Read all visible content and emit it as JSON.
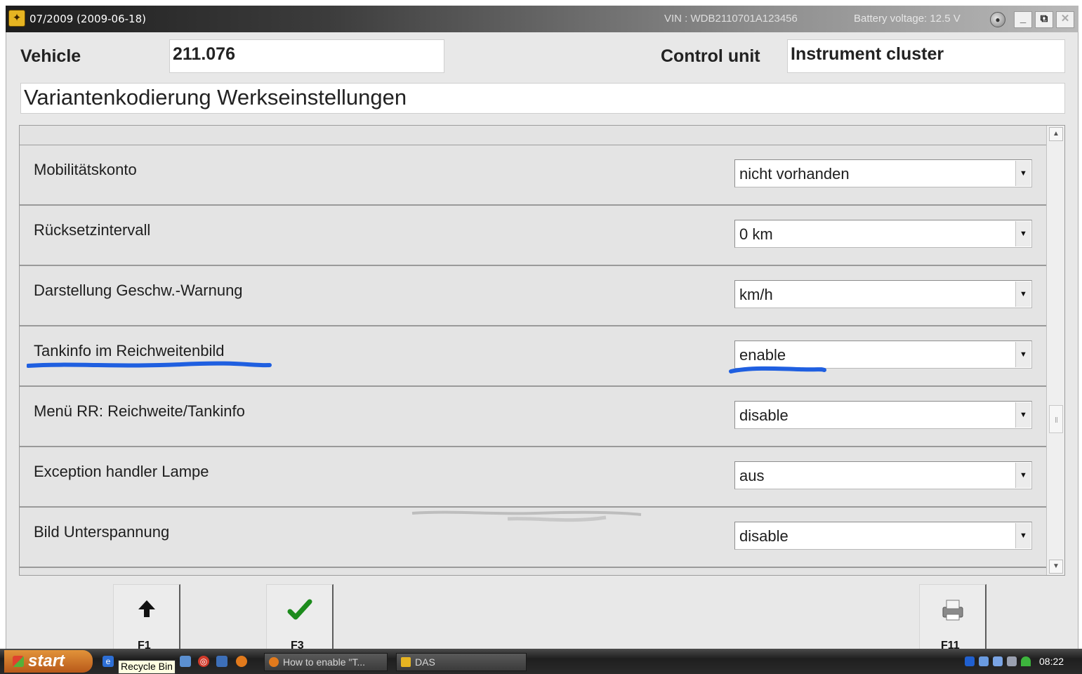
{
  "titlebar": {
    "title": "07/2009 (2009-06-18)",
    "vin": "VIN : WDB2110701A123456",
    "battery": "Battery voltage: 12.5 V"
  },
  "header": {
    "vehicle_label": "Vehicle",
    "vehicle_value": "211.076",
    "control_unit_label": "Control unit",
    "control_unit_value": "Instrument cluster",
    "heading": "Variantenkodierung Werkseinstellungen"
  },
  "rows": [
    {
      "label": "Mobilitätskonto",
      "value": "nicht vorhanden"
    },
    {
      "label": "Rücksetzintervall",
      "value": "0 km"
    },
    {
      "label": "Darstellung Geschw.-Warnung",
      "value": "km/h"
    },
    {
      "label": "Tankinfo im Reichweitenbild",
      "value": "enable"
    },
    {
      "label": "Menü RR: Reichweite/Tankinfo",
      "value": "disable"
    },
    {
      "label": "Exception handler Lampe",
      "value": "aus"
    },
    {
      "label": "Bild Unterspannung",
      "value": "disable"
    }
  ],
  "fkeys": [
    {
      "icon": "up-arrow-icon",
      "label": "F1"
    },
    {
      "icon": "checkmark-icon",
      "label": "F3"
    },
    {
      "icon": "printer-icon",
      "label": "F11"
    }
  ],
  "taskbar": {
    "start_label": "start",
    "recycle_tooltip": "Recycle Bin",
    "tasks": [
      "How to enable \"T...",
      "DAS"
    ],
    "clock": "08:22"
  },
  "colors": {
    "annotation_blue": "#1f5fe0",
    "check_green": "#1c8b1c"
  }
}
